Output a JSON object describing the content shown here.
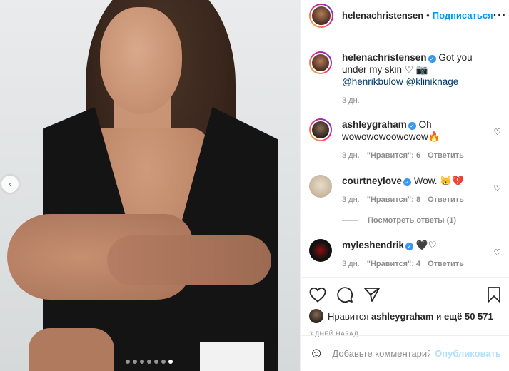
{
  "post": {
    "author": "helenachristensen",
    "dot": "•",
    "follow_label": "Подписаться",
    "more_icon": "more-horizontal-icon",
    "caption_text": "Got you under my skin",
    "caption_emojis": "♡ 📷",
    "caption_mention_1": "@henrikbulow",
    "caption_mention_2": "@kliniknage",
    "caption_time": "3 дн."
  },
  "comments": [
    {
      "user": "ashleygraham",
      "text": "Oh wowowowoowowow🔥",
      "time": "3 дн.",
      "likes": "\"Нравится\": 6",
      "reply": "Ответить"
    },
    {
      "user": "courtneylove",
      "text": "Wow. 😸💔",
      "time": "3 дн.",
      "likes": "\"Нравится\": 8",
      "reply": "Ответить",
      "view_replies": "Посмотреть ответы (1)"
    },
    {
      "user": "myleshendrik",
      "text": "🖤♡",
      "time": "3 дн.",
      "likes": "\"Нравится\": 4",
      "reply": "Ответить"
    }
  ],
  "likes_line": {
    "prefix": "Нравится",
    "user": "ashleygraham",
    "middle": "и",
    "count": "ещё 50 571"
  },
  "date_label": "3 ДНЕЙ НАЗАД",
  "add_comment": {
    "placeholder": "Добавьте комментарий...",
    "publish_label": "Опубликовать"
  },
  "carousel": {
    "prev_icon": "‹",
    "total": 7,
    "active": 7
  }
}
